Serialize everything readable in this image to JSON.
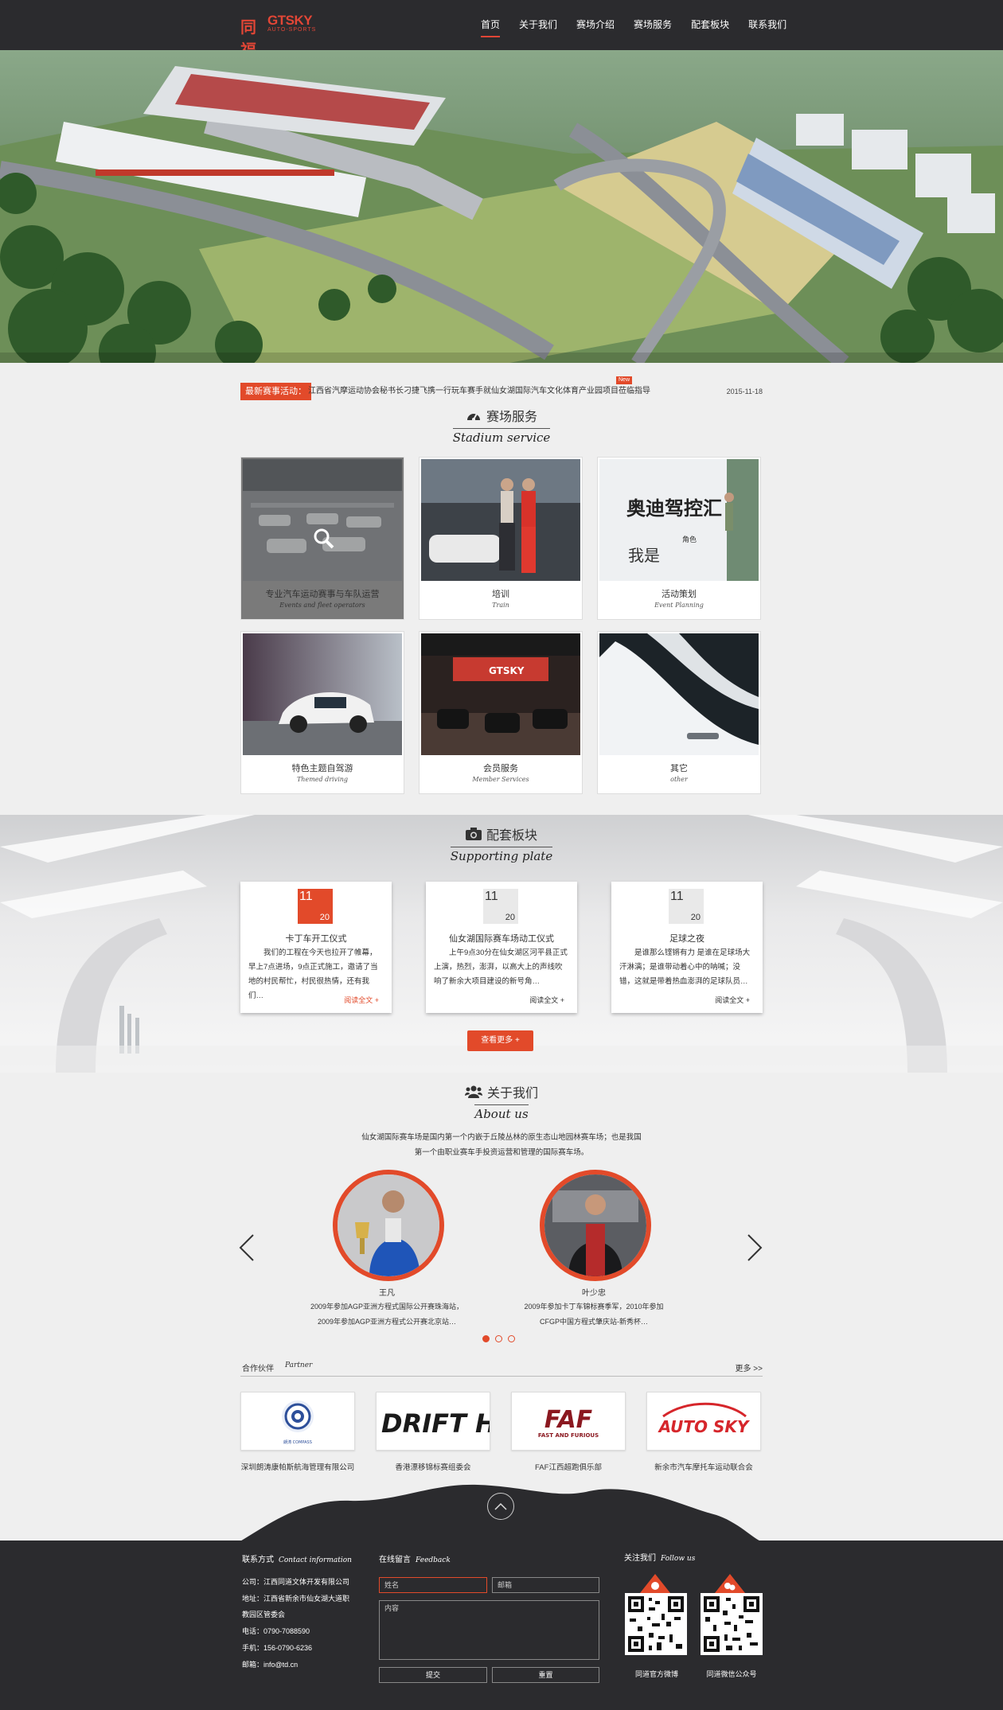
{
  "header": {
    "logo_cn": "同福",
    "logo_en": "GTSKY",
    "logo_sub": "AUTO-SPORTS",
    "nav": [
      "首页",
      "关于我们",
      "赛场介绍",
      "赛场服务",
      "配套板块",
      "联系我们"
    ],
    "active_index": 0
  },
  "ticker": {
    "label": "最新赛事活动：",
    "text": "江西省汽摩运动协会秘书长刁捷飞携一行玩车赛手就仙女湖国际汽车文化体育产业园项目莅临指导",
    "badge": "New",
    "date": "2015-11-18"
  },
  "stadium": {
    "title": "赛场服务",
    "subtitle": "Stadium service",
    "items": [
      {
        "cn": "专业汽车运动赛事与车队运营",
        "en": "Events and fleet operators"
      },
      {
        "cn": "培训",
        "en": "Train"
      },
      {
        "cn": "活动策划",
        "en": "Event Planning"
      },
      {
        "cn": "特色主题自驾游",
        "en": "Themed driving"
      },
      {
        "cn": "会员服务",
        "en": "Member Services"
      },
      {
        "cn": "其它",
        "en": "other"
      }
    ],
    "photo3_text1": "奥迪驾控汇",
    "photo3_text2": "我是",
    "photo3_text3": "角色",
    "photo5_sign": "GTSKY"
  },
  "supporting": {
    "title": "配套板块",
    "subtitle": "Supporting plate",
    "cards": [
      {
        "day": "11",
        "month": "20",
        "title": "卡丁车开工仪式",
        "body": "我们的工程在今天也拉开了帷幕，早上7点进场，9点正式施工，邀请了当地的村民帮忙，村民很热情，还有我们…",
        "more": "阅读全文 +"
      },
      {
        "day": "11",
        "month": "20",
        "title": "仙女湖国际赛车场动工仪式",
        "body": "上午9点30分在仙女湖区河平县正式上演，热烈，澎湃，以高大上的声线吹响了新余大项目建设的新号角…",
        "more": "阅读全文 +"
      },
      {
        "day": "11",
        "month": "20",
        "title": "足球之夜",
        "body": "是谁那么铿锵有力 是谁在足球场大汗淋漓；是谁带动着心中的呐喊；没错，这就是带着热血澎湃的足球队员…",
        "more": "阅读全文 +"
      }
    ],
    "more_button": "查看更多 +"
  },
  "about": {
    "title": "关于我们",
    "subtitle": "About us",
    "intro": "仙女湖国际赛车场是国内第一个内嵌于丘陵丛林的原生态山地园林赛车场；也是我国第一个由职业赛车手投资运营和管理的国际赛车场。",
    "people": [
      {
        "name": "王凡",
        "desc": "2009年参加AGP亚洲方程式国际公开赛珠海站，2009年参加AGP亚洲方程式公开赛北京站…"
      },
      {
        "name": "叶少忠",
        "desc": "2009年参加卡丁车锦标赛季军，2010年参加CFGP中国方程式肇庆站-新秀杯…"
      }
    ],
    "prev_icon": "chevron-left-icon",
    "next_icon": "chevron-right-icon"
  },
  "partners": {
    "title_cn": "合作伙伴",
    "title_en": "Partner",
    "more": "更多 >>",
    "items": [
      {
        "name": "深圳朗涛康帕斯航海管理有限公司",
        "logo_text": "朗涛 COMPASS"
      },
      {
        "name": "香港漂移锦标赛组委会",
        "logo_text": "DRIFT HK"
      },
      {
        "name": "FAF江西超跑俱乐部",
        "logo_text": "FAF",
        "logo_sub": "FAST AND FURIOUS"
      },
      {
        "name": "新余市汽车摩托车运动联合会",
        "logo_text": "AUTO SKY"
      }
    ]
  },
  "footer": {
    "contact_title": "联系方式",
    "contact_title_en": "Contact information",
    "contact_lines": [
      "公司：江西同道文体开发有限公司",
      "地址：江西省新余市仙女湖大道职",
      "教园区管委会",
      "电话：0790-7088590",
      "手机：156-0790-6236",
      "邮箱：info@td.cn"
    ],
    "feedback_title": "在线留言",
    "feedback_title_en": "Feedback",
    "name_placeholder": "姓名",
    "email_placeholder": "邮箱",
    "content_placeholder": "内容",
    "submit": "提交",
    "reset": "重置",
    "follow_title": "关注我们",
    "follow_title_en": "Follow us",
    "qr1_label": "同道官方微博",
    "qr2_label": "同道微信公众号"
  },
  "colors": {
    "accent": "#e24a2a",
    "dark": "#2b2b2e"
  }
}
